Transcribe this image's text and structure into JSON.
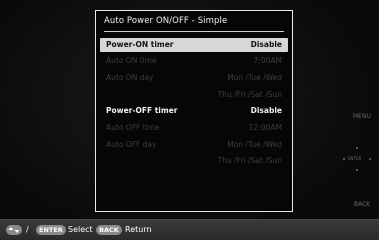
{
  "dialog": {
    "title": "Auto Power ON/OFF - Simple",
    "rows": [
      {
        "label": "Power-ON timer",
        "value": "Disable"
      },
      {
        "label": "Auto ON time",
        "value": "7:00AM"
      },
      {
        "label": "Auto ON day",
        "value": "Mon /Tue /Wed"
      },
      {
        "label": "",
        "value": "Thu /Fri /Sat /Sun"
      },
      {
        "label": "Power-OFF timer",
        "value": "Disable"
      },
      {
        "label": "Auto OFF time",
        "value": "12:00AM"
      },
      {
        "label": "Auto OFF day",
        "value": "Mon /Tue /Wed"
      },
      {
        "label": "",
        "value": "Thu /Fri /Sat /Sun"
      }
    ]
  },
  "side": {
    "menu": "MENU",
    "enter": "ENTER",
    "back": "BACK"
  },
  "footer": {
    "nav_sep": "/",
    "enter_pill": "ENTER",
    "select_label": "Select",
    "back_pill": "BACK",
    "return_label": "Return"
  }
}
